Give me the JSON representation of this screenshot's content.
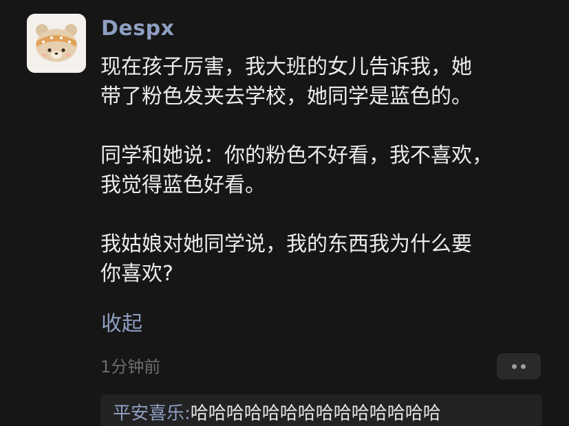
{
  "post": {
    "username": "Despx",
    "paragraphs": [
      "现在孩子厉害，我大班的女儿告诉我，她\n带了粉色发夹去学校，她同学是蓝色的。",
      "同学和她说：你的粉色不好看，我不喜欢，\n我觉得蓝色好看。",
      "我姑娘对她同学说，我的东西我为什么要\n你喜欢?"
    ],
    "collapse_label": "收起",
    "timestamp": "1分钟前"
  },
  "icons": {
    "avatar": "bear-avatar-icon",
    "more": "more-dots-icon"
  },
  "comment": {
    "author": "平安喜乐",
    "separator": ":",
    "text": "哈哈哈哈哈哈哈哈哈哈哈哈哈哈"
  },
  "colors": {
    "background": "#161616",
    "link_accent": "#8e9fc2",
    "body_text": "#ececec",
    "muted_text": "#6c6c6c"
  }
}
